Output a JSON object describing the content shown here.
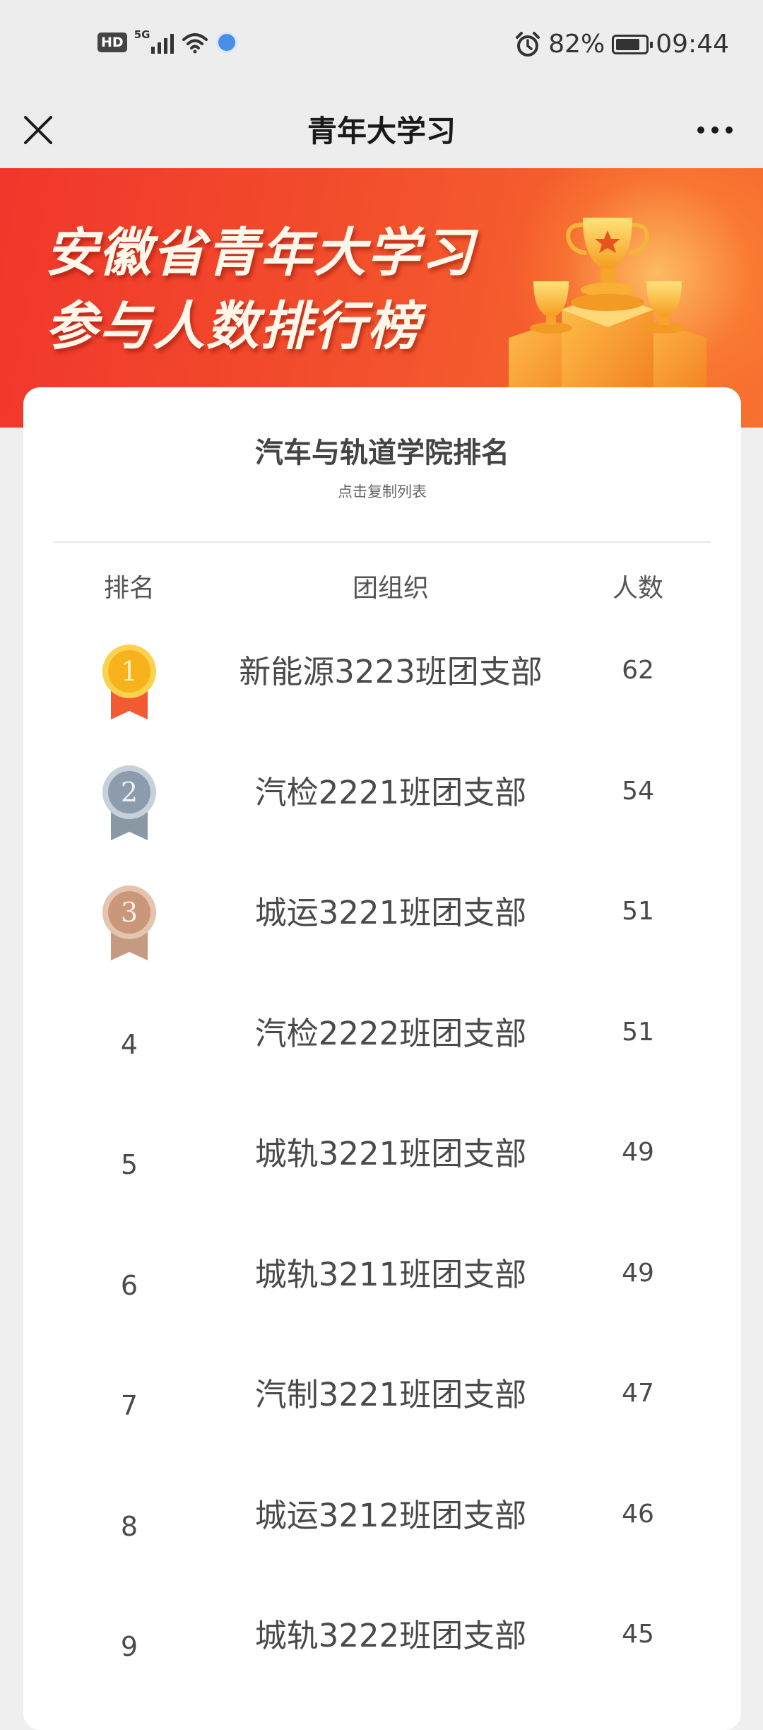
{
  "status_bar": {
    "hd": "HD",
    "network": "5G",
    "battery_percent": "82%",
    "battery_level": 0.82,
    "time": "09:44",
    "icons": [
      "signal-icon",
      "wifi-icon",
      "globe-icon",
      "alarm-icon",
      "battery-icon"
    ]
  },
  "title_bar": {
    "title": "青年大学习",
    "close_icon": "close-icon",
    "more_icon": "more-icon"
  },
  "banner": {
    "line1": "安徽省青年大学习",
    "line2": "参与人数排行榜",
    "colors": {
      "start": "#f1362b",
      "end": "#f8712f"
    }
  },
  "card": {
    "title": "汽车与轨道学院排名",
    "subtitle": "点击复制列表",
    "headers": {
      "rank": "排名",
      "org": "团组织",
      "count": "人数"
    },
    "rows": [
      {
        "rank": "1",
        "org": "新能源3223班团支部",
        "count": "62",
        "medal": "gold"
      },
      {
        "rank": "2",
        "org": "汽检2221班团支部",
        "count": "54",
        "medal": "silver"
      },
      {
        "rank": "3",
        "org": "城运3221班团支部",
        "count": "51",
        "medal": "bronze"
      },
      {
        "rank": "4",
        "org": "汽检2222班团支部",
        "count": "51"
      },
      {
        "rank": "5",
        "org": "城轨3221班团支部",
        "count": "49"
      },
      {
        "rank": "6",
        "org": "城轨3211班团支部",
        "count": "49"
      },
      {
        "rank": "7",
        "org": "汽制3221班团支部",
        "count": "47"
      },
      {
        "rank": "8",
        "org": "城运3212班团支部",
        "count": "46"
      },
      {
        "rank": "9",
        "org": "城轨3222班团支部",
        "count": "45"
      }
    ]
  },
  "medal_colors": {
    "gold": {
      "disc": "#f7b21c",
      "rim": "#fbd24e",
      "ribbon": "#f25a34",
      "text": "#fff3c4"
    },
    "silver": {
      "disc": "#8c9cac",
      "rim": "#c7d1da",
      "ribbon": "#8a98a6",
      "text": "#eef2f6"
    },
    "bronze": {
      "disc": "#c9977a",
      "rim": "#e6c3ac",
      "ribbon": "#c49a80",
      "text": "#fbefe6"
    }
  }
}
